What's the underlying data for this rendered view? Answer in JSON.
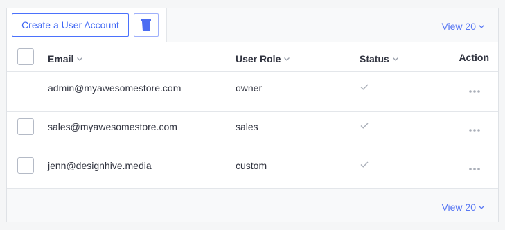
{
  "toolbar": {
    "create_label": "Create a User Account",
    "delete_icon": "trash-icon",
    "view_label": "View 20"
  },
  "table": {
    "columns": {
      "email": "Email",
      "role": "User Role",
      "status": "Status",
      "action": "Action"
    },
    "rows": [
      {
        "email": "admin@myawesomestore.com",
        "role": "owner",
        "status_icon": "check-icon",
        "action_icon": "more-horizontal-icon"
      },
      {
        "email": "sales@myawesomestore.com",
        "role": "sales",
        "status_icon": "check-icon",
        "action_icon": "more-horizontal-icon"
      },
      {
        "email": "jenn@designhive.media",
        "role": "custom",
        "status_icon": "check-icon",
        "action_icon": "more-horizontal-icon"
      }
    ]
  },
  "footer": {
    "view_label": "View 20"
  },
  "colors": {
    "accent": "#3c64f4",
    "border": "#dfe2e6",
    "text": "#313440",
    "muted_icon": "#a9aeb8"
  }
}
